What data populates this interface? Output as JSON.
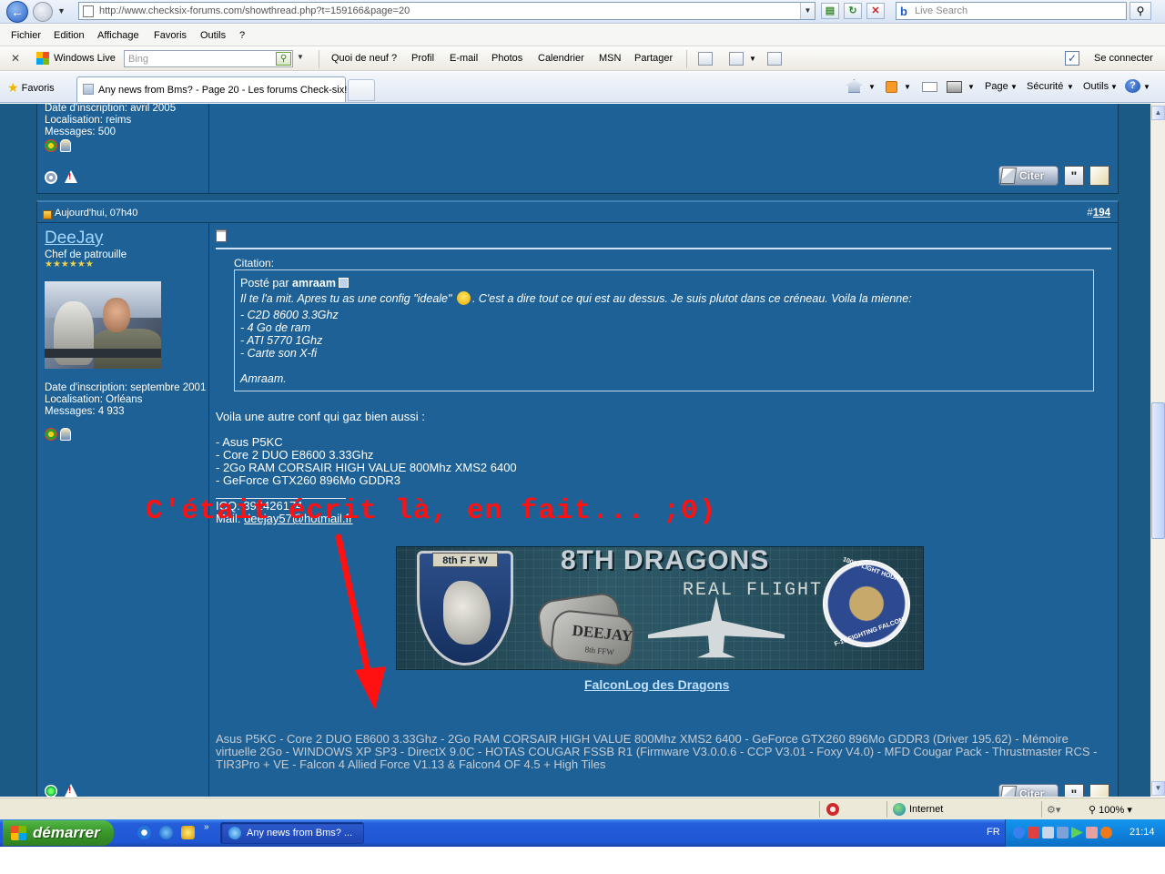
{
  "browser": {
    "url": "http://www.checksix-forums.com/showthread.php?t=159166&page=20",
    "search_placeholder": "Live Search",
    "menu": [
      "Fichier",
      "Edition",
      "Affichage",
      "Favoris",
      "Outils",
      "?"
    ],
    "live_toolbar": {
      "brand": "Windows Live",
      "search_placeholder": "Bing",
      "links": [
        "Quoi de neuf ?",
        "Profil",
        "E-mail",
        "Photos",
        "Calendrier",
        "MSN",
        "Partager"
      ],
      "signin": "Se connecter"
    },
    "favorites_label": "Favoris",
    "tab_title": "Any news from Bms? - Page 20 - Les forums Check-six!",
    "commands": {
      "page": "Page",
      "security": "Sécurité",
      "tools": "Outils"
    }
  },
  "post_prev": {
    "joined": "Date d'inscription: avril 2005",
    "location": "Localisation: reims",
    "messages": "Messages: 500",
    "quote_button": "Citer"
  },
  "post": {
    "date": "Aujourd'hui, 07h40",
    "number_prefix": "#",
    "number": "194",
    "username": "DeeJay",
    "user_title": "Chef de patrouille",
    "stars": "★★★★★★",
    "joined": "Date d'inscription: septembre 2001",
    "location": "Localisation: Orléans",
    "messages": "Messages: 4 933",
    "quote_label": "Citation:",
    "quote_by_prefix": "Posté par",
    "quote_author": "amraam",
    "quote_line1a": "Il te l'a mit. Apres tu as une config \"ideale\"",
    "quote_line1b": ". C'est a dire tout ce qui est au dessus. Je suis plutot dans ce créneau. Voila la mienne:",
    "quote_items": [
      "- C2D 8600 3.3Ghz",
      "- 4 Go de ram",
      "- ATI 5770 1Ghz",
      "- Carte son X-fi"
    ],
    "quote_sign": "Amraam.",
    "intro": "Voila une autre conf qui gaz bien aussi :",
    "config": [
      "- Asus P5KC",
      "- Core 2 DUO E8600 3.33Ghz",
      "- 2Go RAM CORSAIR HIGH VALUE 800Mhz XMS2 6400",
      "- GeForce GTX260 896Mo GDDR3"
    ],
    "icq": "ICQ: 392426174",
    "mail_prefix": "Mail:",
    "mail": "deejay57@hotmail.fr",
    "banner": {
      "tag": "8th F F W",
      "title": "8TH DRAGONS",
      "subtitle": "REAL FLIGHT",
      "dogtag_name": "DEEJAY",
      "dogtag_unit": "8th FFW",
      "patch_top": "1000 FLIGHT HOURS",
      "patch_bottom": "F-16 FIGHTING FALCON"
    },
    "signature_link": "FalconLog des Dragons",
    "tech_signature": "Asus P5KC - Core 2 DUO E8600 3.33Ghz - 2Go RAM CORSAIR HIGH VALUE 800Mhz XMS2 6400 - GeForce GTX260 896Mo GDDR3 (Driver 195.62) - Mémoire virtuelle 2Go - WINDOWS XP SP3 - DirectX 9.0C - HOTAS COUGAR FSSB R1 (Firmware V3.0.0.6 - CCP V3.01 - Foxy V4.0) - MFD Cougar Pack - Thrustmaster RCS - TIR3Pro + VE - Falcon 4 Allied Force V1.13 & Falcon4 OF 4.5 + High Tiles",
    "quote_button": "Citer"
  },
  "annotation": "C'était écrit là, en fait... ;0)",
  "status": {
    "zone": "Internet",
    "zoom": "100%"
  },
  "taskbar": {
    "start": "démarrer",
    "window": "Any news from Bms? ...",
    "lang": "FR",
    "clock": "21:14"
  },
  "colors": {
    "forum_bg": "#1c5a86",
    "post_bg": "#1d6196",
    "annotation": "#ff1111"
  }
}
